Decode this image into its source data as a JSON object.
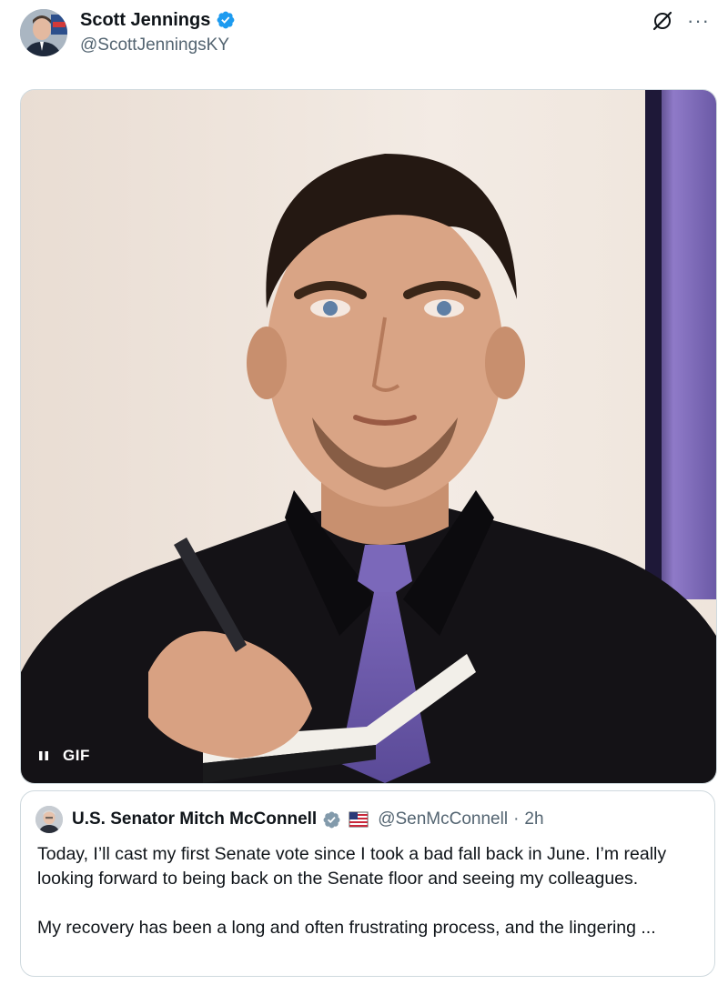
{
  "author": {
    "name": "Scott Jennings",
    "handle": "@ScottJenningsKY",
    "verified": true,
    "avatar_icon": "person-photo-icon"
  },
  "header_actions": {
    "grok_icon": "slashed-circle-icon",
    "more_label": "···"
  },
  "media": {
    "type": "gif",
    "gif_label": "GIF",
    "pause_icon": "pause-icon"
  },
  "quote": {
    "name": "U.S. Senator Mitch McConnell",
    "handle": "@SenMcConnell",
    "separator": "·",
    "time": "2h",
    "paragraph1": "Today, I’ll cast my first Senate vote since I took a bad fall back in June. I’m really looking forward to being back on the Senate floor and seeing my colleagues.",
    "paragraph2": "My recovery has been a long and often frustrating process, and the lingering ..."
  },
  "colors": {
    "verified_blue": "#1d9bf0",
    "gov_gray": "#829aab",
    "text_primary": "#0f1419",
    "text_secondary": "#536471",
    "border": "#cfd9de"
  }
}
